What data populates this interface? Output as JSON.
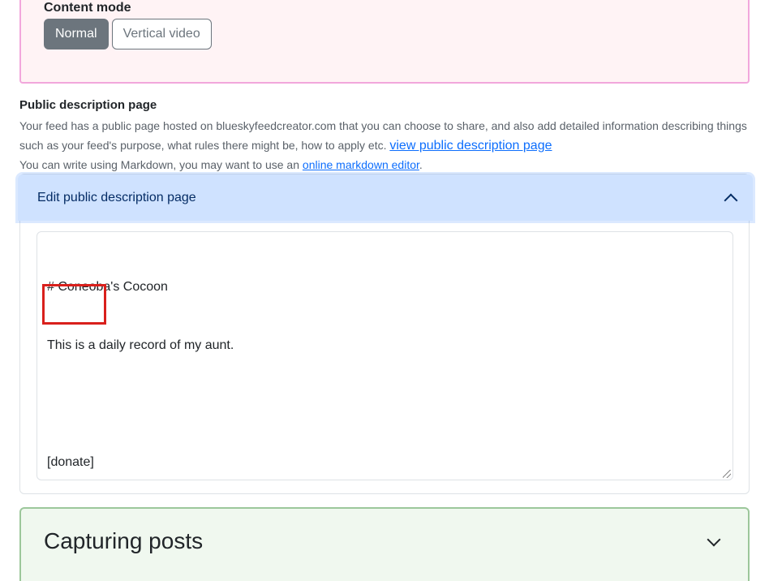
{
  "content_mode": {
    "title": "Content mode",
    "options": [
      "Normal",
      "Vertical video"
    ],
    "selected": "Normal"
  },
  "public_description": {
    "title": "Public description page",
    "description": "Your feed has a public page hosted on blueskyfeedcreator.com that you can choose to share, and also add detailed information describing things such as your feed's purpose, what rules there might be, how to apply etc.",
    "view_link": "view public description page",
    "markdown_prefix": "You can write using Markdown, you may want to use an",
    "markdown_link": "online markdown editor",
    "markdown_suffix": "."
  },
  "accordion": {
    "header": "Edit public description page",
    "expanded": true,
    "editor_lines": [
      "# Coneoba's Cocoon",
      "This is a daily record of my aunt.",
      "",
      "[donate]"
    ]
  },
  "capturing_posts": {
    "title": "Capturing posts",
    "expanded": false
  },
  "colors": {
    "accent_link": "#0d6efd",
    "highlight_box": "#d9201c",
    "pink_border": "#f2a7dc",
    "green_border": "#9cc79b"
  }
}
